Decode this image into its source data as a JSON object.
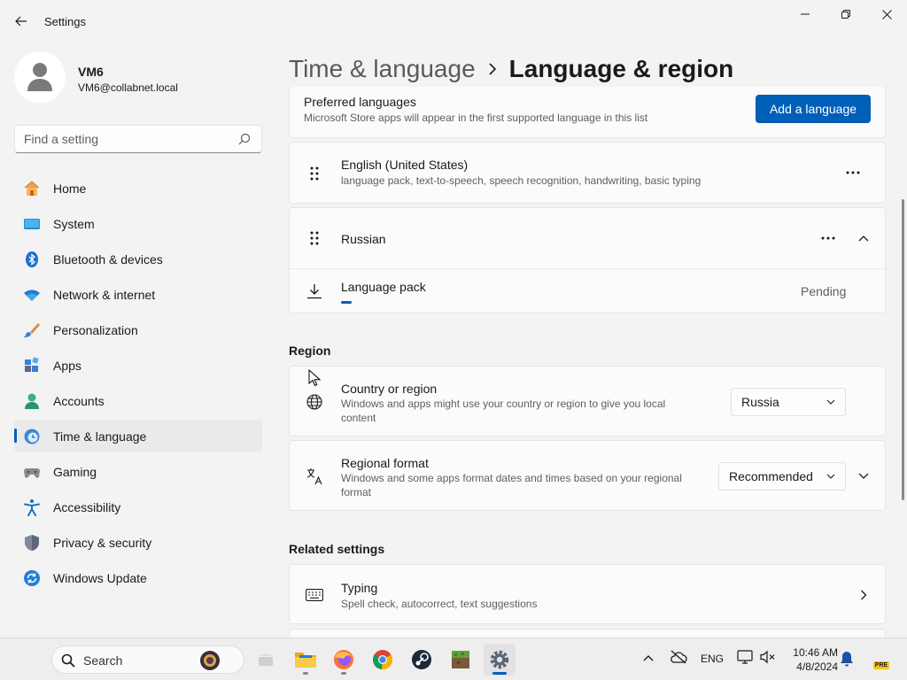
{
  "window": {
    "title": "Settings"
  },
  "profile": {
    "name": "VM6",
    "email": "VM6@collabnet.local"
  },
  "search": {
    "placeholder": "Find a setting"
  },
  "nav": {
    "items": [
      {
        "label": "Home",
        "icon": "home-icon"
      },
      {
        "label": "System",
        "icon": "system-icon"
      },
      {
        "label": "Bluetooth & devices",
        "icon": "bluetooth-icon"
      },
      {
        "label": "Network & internet",
        "icon": "wifi-icon"
      },
      {
        "label": "Personalization",
        "icon": "brush-icon"
      },
      {
        "label": "Apps",
        "icon": "apps-icon"
      },
      {
        "label": "Accounts",
        "icon": "accounts-icon"
      },
      {
        "label": "Time & language",
        "icon": "time-language-icon",
        "active": true
      },
      {
        "label": "Gaming",
        "icon": "gaming-icon"
      },
      {
        "label": "Accessibility",
        "icon": "accessibility-icon"
      },
      {
        "label": "Privacy & security",
        "icon": "shield-icon"
      },
      {
        "label": "Windows Update",
        "icon": "update-icon"
      }
    ]
  },
  "breadcrumb": {
    "parent": "Time & language",
    "current": "Language & region"
  },
  "preferred": {
    "title": "Preferred languages",
    "subtitle": "Microsoft Store apps will appear in the first supported language in this list",
    "add_button": "Add a language"
  },
  "languages": [
    {
      "name": "English (United States)",
      "features": "language pack, text-to-speech, speech recognition, handwriting, basic typing"
    },
    {
      "name": "Russian",
      "features": ""
    }
  ],
  "language_pack": {
    "label": "Language pack",
    "status": "Pending",
    "progress_fraction": 0.02
  },
  "region": {
    "heading": "Region",
    "country": {
      "title": "Country or region",
      "subtitle": "Windows and apps might use your country or region to give you local content",
      "value": "Russia"
    },
    "format": {
      "title": "Regional format",
      "subtitle": "Windows and some apps format dates and times based on your regional format",
      "value": "Recommended"
    }
  },
  "related": {
    "heading": "Related settings",
    "typing": {
      "title": "Typing",
      "subtitle": "Spell check, autocorrect, text suggestions"
    }
  },
  "taskbar": {
    "search_label": "Search",
    "language": "ENG",
    "time": "10:46 AM",
    "date": "4/8/2024",
    "pre_badge": "PRE"
  },
  "colors": {
    "accent": "#005fb8",
    "background": "#f3f3f3",
    "card": "#fbfbfb"
  }
}
